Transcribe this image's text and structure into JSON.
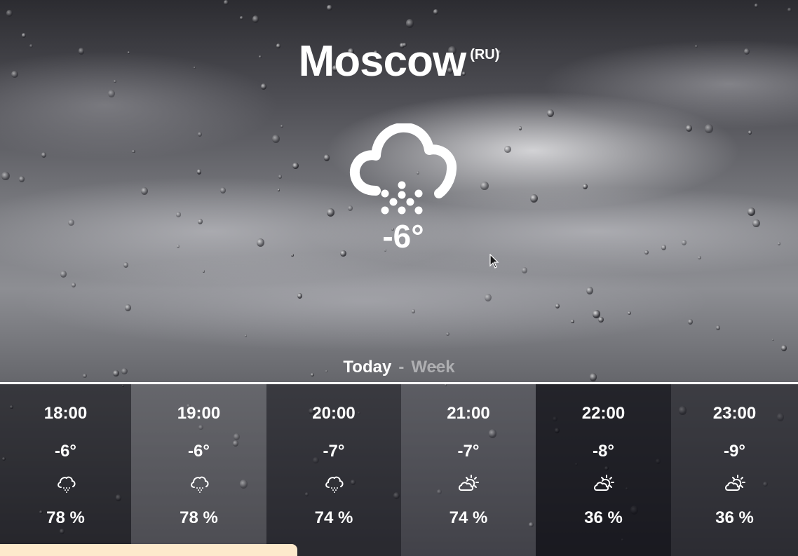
{
  "header": {
    "city": "Moscow",
    "country": "(RU)"
  },
  "current": {
    "temperature": "-6°",
    "icon": "cloud-snow-icon"
  },
  "tabs": {
    "today": "Today",
    "separator": "-",
    "week": "Week"
  },
  "hourly": [
    {
      "time": "18:00",
      "temp": "-6°",
      "icon": "cloud-snow-icon",
      "humidity": "78 %"
    },
    {
      "time": "19:00",
      "temp": "-6°",
      "icon": "cloud-snow-icon",
      "humidity": "78 %"
    },
    {
      "time": "20:00",
      "temp": "-7°",
      "icon": "cloud-snow-icon",
      "humidity": "74 %"
    },
    {
      "time": "21:00",
      "temp": "-7°",
      "icon": "partly-cloudy-sun-icon",
      "humidity": "74 %"
    },
    {
      "time": "22:00",
      "temp": "-8°",
      "icon": "partly-cloudy-sun-icon",
      "humidity": "36 %"
    },
    {
      "time": "23:00",
      "temp": "-9°",
      "icon": "partly-cloudy-sun-icon",
      "humidity": "36 %"
    }
  ],
  "colors": {
    "text": "#ffffff",
    "bottom_bar": "#fde9cc",
    "divider": "#ffffff"
  }
}
